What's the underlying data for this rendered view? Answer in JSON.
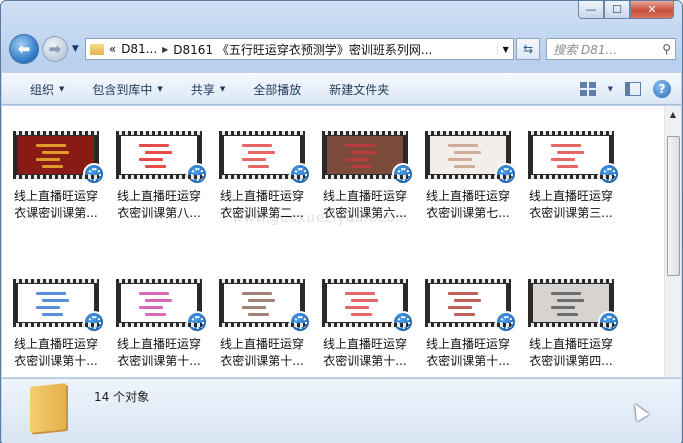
{
  "window": {
    "minimize": "—",
    "maximize": "☐",
    "close": "✕"
  },
  "nav": {
    "back_icon": "back-arrow-icon",
    "forward_icon": "forward-arrow-icon",
    "path_prefix": "«",
    "crumb1": "D81...",
    "crumb2": "D8161 《五行旺运穿衣预测学》密训班系列网...",
    "search_placeholder": "搜索 D81..."
  },
  "toolbar": {
    "items": [
      "组织",
      "包含到库中",
      "共享",
      "全部播放",
      "新建文件夹"
    ]
  },
  "watermark": "www.guoxueziyuan.com",
  "files": [
    {
      "label": "线上直播旺运穿\n衣课密训课第...",
      "bg": "#8a1a14",
      "accent": "#f0b12c"
    },
    {
      "label": "线上直播旺运穿\n衣密训课第八...",
      "bg": "#ffffff",
      "accent": "#e02a2a"
    },
    {
      "label": "线上直播旺运穿\n衣密训课第二...",
      "bg": "#ffffff",
      "accent": "#e24b4b"
    },
    {
      "label": "线上直播旺运穿\n衣密训课第六...",
      "bg": "#7b4a3a",
      "accent": "#c23b3b"
    },
    {
      "label": "线上直播旺运穿\n衣密训课第七...",
      "bg": "#f3eeea",
      "accent": "#c9a08c"
    },
    {
      "label": "线上直播旺运穿\n衣密训课第三...",
      "bg": "#ffffff",
      "accent": "#e24b4b"
    },
    {
      "label": "线上直播旺运穿\n衣密训课第十...",
      "bg": "#ffffff",
      "accent": "#3d7bd6"
    },
    {
      "label": "线上直播旺运穿\n衣密训课第十...",
      "bg": "#ffffff",
      "accent": "#d44fb0"
    },
    {
      "label": "线上直播旺运穿\n衣密训课第十...",
      "bg": "#ffffff",
      "accent": "#8f6d5c"
    },
    {
      "label": "线上直播旺运穿\n衣密训课第十...",
      "bg": "#ffffff",
      "accent": "#e24b4b"
    },
    {
      "label": "线上直播旺运穿\n衣密训课第十...",
      "bg": "#ffffff",
      "accent": "#b9433e"
    },
    {
      "label": "线上直播旺运穿\n衣密训课第四...",
      "bg": "#d6d3d0",
      "accent": "#5b5b5b"
    }
  ],
  "status": {
    "count_text": "14 个对象"
  }
}
